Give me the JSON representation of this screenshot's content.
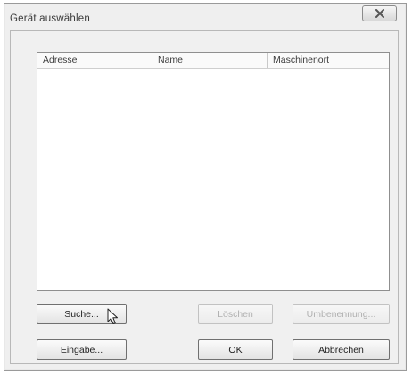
{
  "window": {
    "title": "Gerät auswählen",
    "close_icon": "close-icon"
  },
  "list": {
    "columns": [
      "Adresse",
      "Name",
      "Maschinenort"
    ],
    "rows": []
  },
  "buttons": {
    "search": "Suche...",
    "delete": "Löschen",
    "rename": "Umbenennung...",
    "enter": "Eingabe...",
    "ok": "OK",
    "cancel": "Abbrechen"
  },
  "cursor": {
    "icon": "mouse-pointer-icon"
  }
}
